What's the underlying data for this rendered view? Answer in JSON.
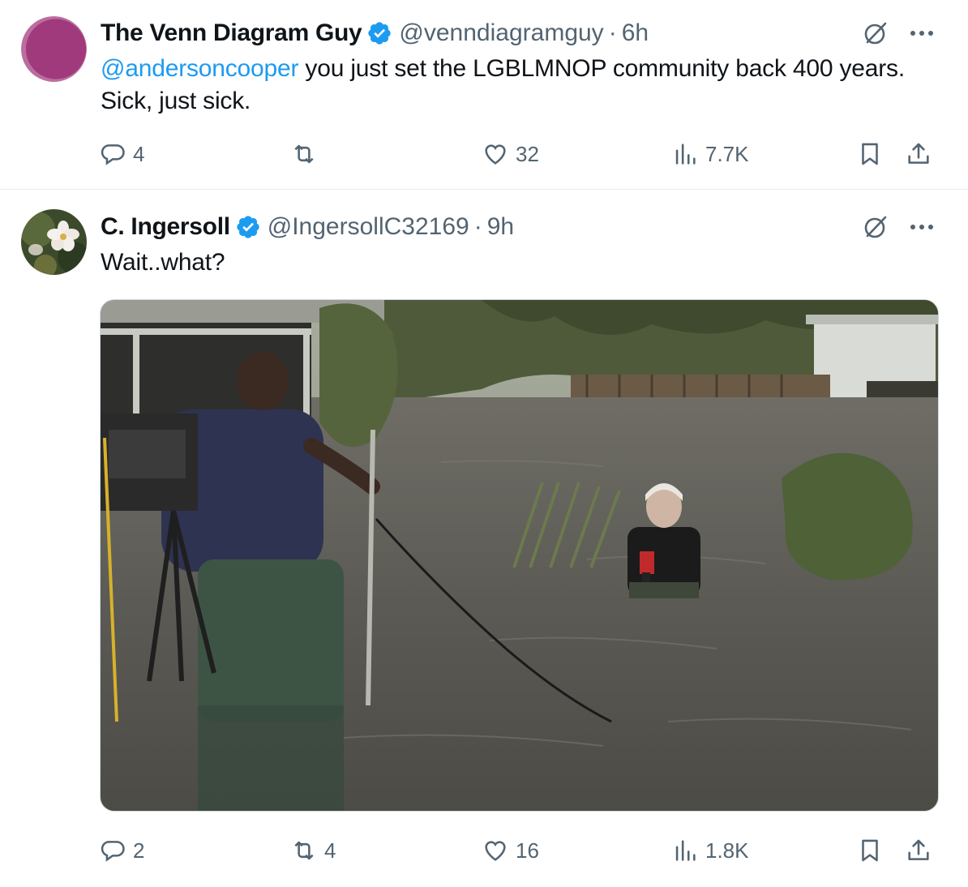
{
  "tweets": [
    {
      "author": {
        "display_name": "The Venn Diagram Guy",
        "handle": "@venndiagramguy",
        "verified": true,
        "avatar": "pink-circle-avatar"
      },
      "time": "6h",
      "text": {
        "mention": "@andersoncooper",
        "body": " you just set the LGBLMNOP community back 400 years. Sick, just sick."
      },
      "stats": {
        "replies": "4",
        "reposts": "",
        "likes": "32",
        "views": "7.7K"
      }
    },
    {
      "author": {
        "display_name": "C. Ingersoll",
        "handle": "@IngersollC32169",
        "verified": true,
        "avatar": "flower-avatar"
      },
      "time": "9h",
      "text": {
        "body": "Wait..what?"
      },
      "media": {
        "description": "flooded-street-news-crew-photo"
      },
      "stats": {
        "replies": "2",
        "reposts": "4",
        "likes": "16",
        "views": "1.8K"
      }
    }
  ],
  "separator": "·",
  "icons": [
    "verified-badge-icon",
    "grok-icon",
    "more-icon",
    "reply-icon",
    "repost-icon",
    "like-icon",
    "views-icon",
    "bookmark-icon",
    "share-icon"
  ],
  "colors": {
    "accent": "#1d9bf0",
    "secondary_text": "#536471",
    "primary_text": "#0f1419"
  }
}
